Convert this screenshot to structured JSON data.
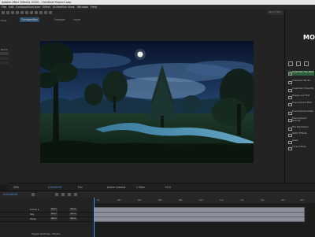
{
  "window": {
    "title": "Adobe After Effects 2020 - Untitled Project.aep"
  },
  "menu": [
    "File",
    "Edit",
    "Composition",
    "Layer",
    "Effect",
    "Animation",
    "View",
    "Window",
    "Help"
  ],
  "toolbar": {
    "search": "Search Help"
  },
  "left_panel": {
    "lines": [
      "Proje",
      "Name",
      "",
      "",
      "",
      ""
    ]
  },
  "comp": {
    "tabs": [
      "Composition",
      "Footage",
      "Layer"
    ],
    "name": "Comp 1"
  },
  "right_panel": {
    "logo": "MO",
    "items": [
      {
        "label": "Cinematic Sky Pack",
        "selected": true
      },
      {
        "label": "Character Rocks",
        "selected": false
      },
      {
        "label": "Cinematic Smooths",
        "selected": false
      },
      {
        "label": "Design and Flat",
        "selected": false
      },
      {
        "label": "Environment Pack",
        "selected": false
      },
      {
        "label": "Environment Grass",
        "selected": false
      },
      {
        "label": "Environment Tutorial",
        "selected": false
      },
      {
        "label": "Fire Explosions",
        "selected": false
      },
      {
        "label": "Glitch Effects",
        "selected": false
      },
      {
        "label": "Glass",
        "selected": false
      },
      {
        "label": "TV and More",
        "selected": false
      }
    ]
  },
  "viewer_bar": {
    "zoom": "50%",
    "time": "0:00:00:00",
    "quality": "Full",
    "camera": "Active Camera",
    "views": "1 View",
    "offset": "+0.0"
  },
  "timeline": {
    "time": "0:00:00:00",
    "ruler": [
      "0s",
      "02s",
      "04s",
      "06s",
      "08s",
      "10s",
      "12s",
      "14s",
      "16s",
      "18s",
      "20s"
    ],
    "layers": [
      {
        "name": "Comp 1",
        "mode": "Norm",
        "matte": "None"
      },
      {
        "name": "Sky",
        "mode": "Norm",
        "matte": "None"
      },
      {
        "name": "Trees",
        "mode": "Norm",
        "matte": "None"
      }
    ],
    "bottom": "Toggle Switches / Modes"
  }
}
